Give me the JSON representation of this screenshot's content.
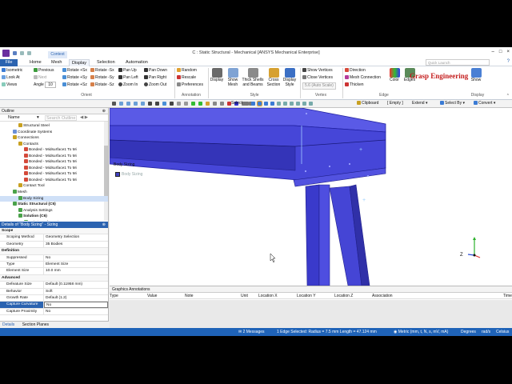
{
  "window": {
    "title": "C : Static Structural - Mechanical [ANSYS Mechanical Enterprise]",
    "context_tab": "Context",
    "search_placeholder": "Quick Launch"
  },
  "tabs": [
    "File",
    "Home",
    "Mesh",
    "Display",
    "Selection",
    "Automation"
  ],
  "ribbon": {
    "orient": {
      "items": [
        "Isometric",
        "Look At",
        "Views",
        "Previous",
        "Next",
        "Angle",
        "Rotate +Sx",
        "Rotate +Sy",
        "Rotate +Sz",
        "Rotate -Sx",
        "Rotate -Sy",
        "Rotate -Sz",
        "Pan Up",
        "Pan Left",
        "Zoom In",
        "Pan Down",
        "Pan Right",
        "Zoom Out"
      ],
      "angle_value": "10",
      "label": "Orient"
    },
    "annotation": {
      "items": [
        "Random",
        "Rescale",
        "Preferences"
      ],
      "label": "Annotation"
    },
    "style": {
      "items": [
        "Display",
        "Show Mesh",
        "Thick Shells and Beams",
        "Cross Section",
        "Display Style"
      ],
      "label": "Style"
    },
    "vertex": {
      "items": [
        "Show Vertices",
        "Close Vertices",
        "5.6 (Auto Scale)"
      ],
      "label": "Vertex"
    },
    "edge": {
      "items": [
        "Direction",
        "Mesh Connection",
        "Thicken",
        "Color",
        "Edges"
      ],
      "label": "Edge"
    },
    "display": {
      "items": [
        "Show",
        "Display"
      ],
      "label": "Display"
    },
    "watermark": "Grasp Engineering"
  },
  "toolbar": {
    "select": "Select",
    "clipboard": "Clipboard",
    "empty": "[ Empty ]",
    "extend": "Extend",
    "select_by": "Select By",
    "convert": "Convert"
  },
  "outline": {
    "title": "Outline",
    "name_header": "Name",
    "search_placeholder": "Search Outline",
    "items": [
      {
        "label": "Structural Steel",
        "indent": 3,
        "color": "#c8a020"
      },
      {
        "label": "Coordinate Systems",
        "indent": 2,
        "color": "#6a8fd6"
      },
      {
        "label": "Connections",
        "indent": 2,
        "color": "#c8a020"
      },
      {
        "label": "Contacts",
        "indent": 3,
        "color": "#c8a020"
      },
      {
        "label": "Bonded - Midsurface1 To Mi",
        "indent": 4,
        "color": "#d44a3a"
      },
      {
        "label": "Bonded - Midsurface1 To Mi",
        "indent": 4,
        "color": "#d44a3a"
      },
      {
        "label": "Bonded - Midsurface1 To Mi",
        "indent": 4,
        "color": "#d44a3a"
      },
      {
        "label": "Bonded - Midsurface1 To Mi",
        "indent": 4,
        "color": "#d44a3a"
      },
      {
        "label": "Bonded - Midsurface1 To Mi",
        "indent": 4,
        "color": "#d44a3a"
      },
      {
        "label": "Bonded - Midsurface1 To Mi",
        "indent": 4,
        "color": "#d44a3a"
      },
      {
        "label": "Contact Tool",
        "indent": 3,
        "color": "#c8a020"
      },
      {
        "label": "Mesh",
        "indent": 2,
        "color": "#4aa24a"
      },
      {
        "label": "Body Sizing",
        "indent": 3,
        "color": "#4aa24a"
      },
      {
        "label": "Static Structural (C5)",
        "indent": 2,
        "color": "#4aa24a",
        "bold": true
      },
      {
        "label": "Analysis Settings",
        "indent": 3,
        "color": "#4aa24a"
      },
      {
        "label": "Solution (C6)",
        "indent": 3,
        "color": "#4aa24a",
        "bold": true
      },
      {
        "label": "Solution Information",
        "indent": 4,
        "color": "#4aa24a"
      }
    ]
  },
  "details": {
    "title": "Details of \"Body Sizing\" - Sizing",
    "rows": [
      {
        "section": "Scope"
      },
      {
        "k": "Scoping Method",
        "v": "Geometry Selection"
      },
      {
        "k": "Geometry",
        "v": "35 Bodies"
      },
      {
        "section": "Definition"
      },
      {
        "k": "Suppressed",
        "v": "No"
      },
      {
        "k": "Type",
        "v": "Element Size"
      },
      {
        "k": "Element Size",
        "v": "10.0 mm"
      },
      {
        "section": "Advanced"
      },
      {
        "k": "Defeature Size",
        "v": "Default (0.11958 mm)"
      },
      {
        "k": "Behavior",
        "v": "Soft"
      },
      {
        "k": "Growth Rate",
        "v": "Default (1.2)"
      },
      {
        "k": "Capture Curvature",
        "v": "No",
        "highlight": true
      },
      {
        "k": "Capture Proximity",
        "v": "No"
      }
    ],
    "bottom_tabs": [
      "Details",
      "Section Planes"
    ]
  },
  "viewport": {
    "label": "Body Sizing",
    "legend": "Body Sizing"
  },
  "annotations": {
    "title": "Graphics Annotations",
    "columns": [
      "Type",
      "Value",
      "Note",
      "Unit",
      "Location X",
      "Location Y",
      "Location Z",
      "Association",
      "Time"
    ]
  },
  "status": {
    "messages": "2 Messages",
    "selection": "1 Edge Selected: Radius = 7.5 mm  Length = 47.124 mm",
    "units": "Metric (mm, t, N, s, mV, mA)",
    "angle": "Degrees",
    "rate": "rad/s",
    "temp": "Celsius"
  },
  "colors": {
    "accent": "#1f63b8",
    "body": "#4a4ad8",
    "body_dark": "#23237a"
  }
}
